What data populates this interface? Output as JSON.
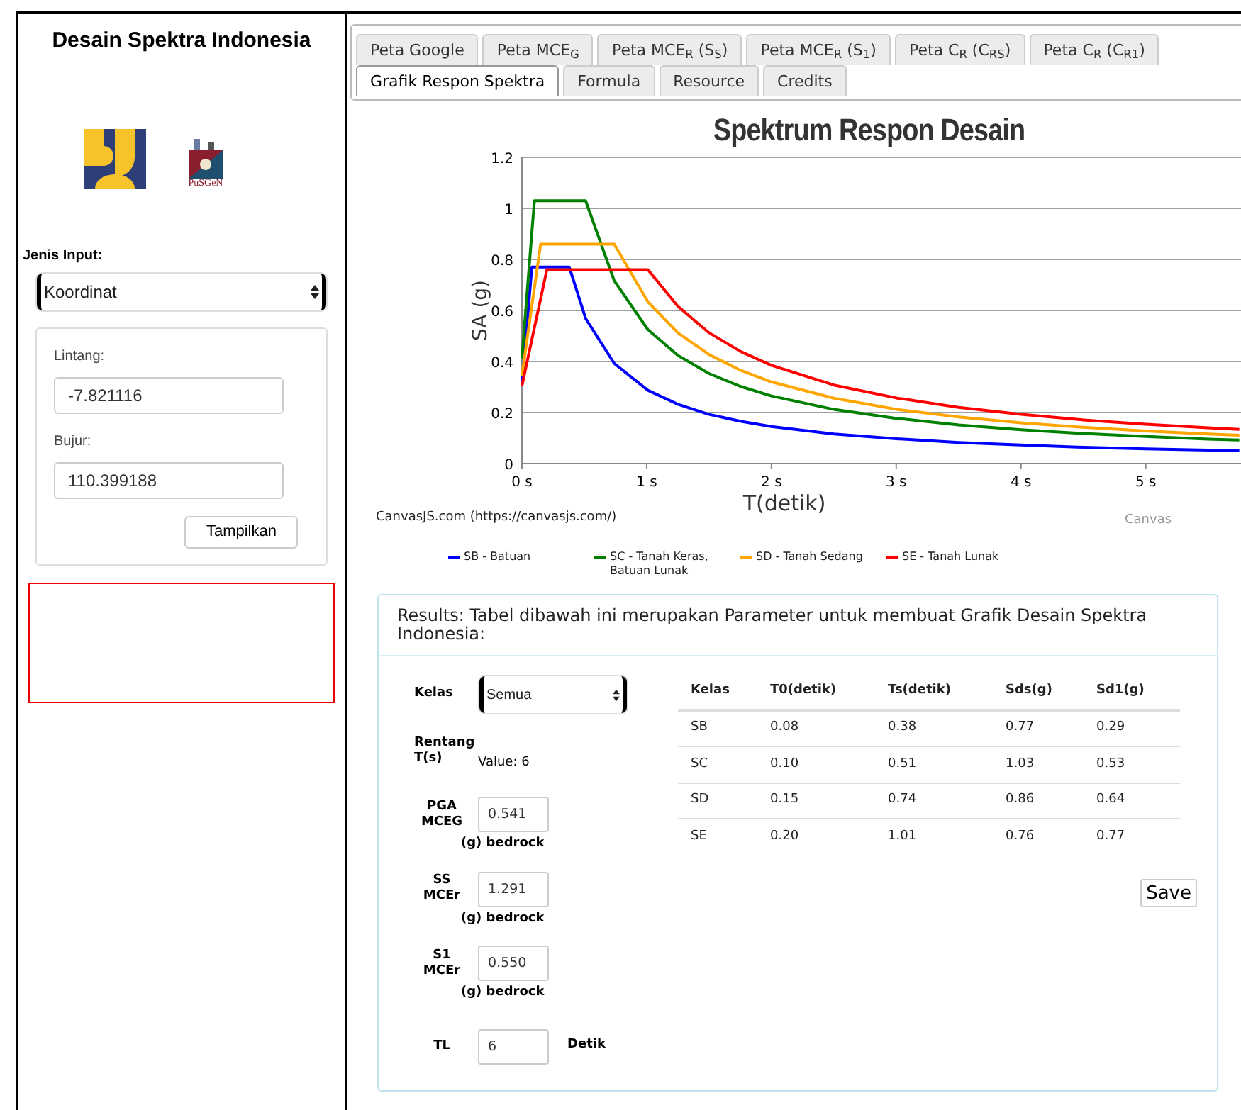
{
  "sidebar": {
    "title": "Desain Spektra Indonesia",
    "logo_text": "PuSGeN",
    "input_type_label": "Jenis Input:",
    "input_type": "Koordinat",
    "fields": [
      {
        "label": "Lintang:",
        "value": "-7.821116"
      },
      {
        "label": "Bujur:",
        "value": "110.399188"
      }
    ],
    "button": "Tampilkan"
  },
  "tabs": [
    {
      "label": "Peta Google",
      "selected": false
    },
    {
      "label": "Peta MCE$_{G}$",
      "selected": false
    },
    {
      "label": "Peta MCE$_{R}$ (S$_{S}$)",
      "selected": false
    },
    {
      "label": "Peta MCE$_{R}$ (S$_{1}$)",
      "selected": false
    },
    {
      "label": "Peta C$_{R}$ (C$_{RS}$)",
      "selected": false
    },
    {
      "label": "Peta C$_{R}$ (C$_{R1}$)",
      "selected": false
    },
    {
      "label": "Grafik Respon Spektra",
      "selected": true
    },
    {
      "label": "Formula",
      "selected": false
    },
    {
      "label": "Resource",
      "selected": false
    },
    {
      "label": "Credits",
      "selected": false
    }
  ],
  "chart": {
    "credit_link": "CanvasJS.com (https://canvasjs.com/)",
    "credit_cut": "Canvas",
    "chart_data": {
      "type": "line",
      "title": "Spektrum Respon Desain",
      "xlabel": "T(detik)",
      "ylabel": "SA (g)",
      "x": [
        0,
        0.08,
        0.1,
        0.15,
        0.2,
        0.38,
        0.51,
        0.74,
        1.01,
        1.25,
        1.5,
        1.75,
        2,
        2.5,
        3,
        3.5,
        4,
        4.5,
        5,
        5.5,
        5.75
      ],
      "series": [
        {
          "name": "SB - Batuan",
          "color": "#0000ff",
          "values": [
            0.308,
            0.77,
            0.77,
            0.77,
            0.77,
            0.77,
            0.569,
            0.392,
            0.287,
            0.232,
            0.193,
            0.166,
            0.145,
            0.116,
            0.097,
            0.083,
            0.073,
            0.064,
            0.058,
            0.053,
            0.05
          ]
        },
        {
          "name": "SC - Tanah Keras, Batuan Lunak",
          "color": "#008000",
          "values": [
            0.412,
            0.906,
            1.03,
            1.03,
            1.03,
            1.03,
            1.03,
            0.716,
            0.525,
            0.424,
            0.353,
            0.303,
            0.265,
            0.212,
            0.177,
            0.151,
            0.133,
            0.118,
            0.106,
            0.096,
            0.092
          ]
        },
        {
          "name": "SD - Tanah Sedang",
          "color": "#ffa500",
          "values": [
            0.344,
            0.619,
            0.688,
            0.86,
            0.86,
            0.86,
            0.86,
            0.86,
            0.634,
            0.512,
            0.427,
            0.366,
            0.32,
            0.256,
            0.213,
            0.183,
            0.16,
            0.142,
            0.128,
            0.116,
            0.111
          ]
        },
        {
          "name": "SE - Tanah Lunak",
          "color": "#ff0000",
          "values": [
            0.304,
            0.486,
            0.532,
            0.646,
            0.76,
            0.76,
            0.76,
            0.76,
            0.76,
            0.616,
            0.513,
            0.44,
            0.385,
            0.308,
            0.257,
            0.22,
            0.193,
            0.171,
            0.154,
            0.14,
            0.134
          ]
        }
      ],
      "xlim": [
        0,
        5.9
      ],
      "ylim": [
        0,
        1.2
      ],
      "grid": true,
      "legend": "bottom",
      "xticks": [
        {
          "value": 0,
          "label": "0 s"
        },
        {
          "value": 1,
          "label": "1 s"
        },
        {
          "value": 2,
          "label": "2 s"
        },
        {
          "value": 3,
          "label": "3 s"
        },
        {
          "value": 4,
          "label": "4 s"
        },
        {
          "value": 5,
          "label": "5 s"
        }
      ],
      "yticks": [
        0,
        0.2,
        0.4,
        0.6,
        0.8,
        1,
        1.2
      ]
    }
  },
  "results": {
    "heading": "Results: Tabel dibawah ini merupakan Parameter untuk membuat Grafik Desain Spektra Indonesia:",
    "form": [
      {
        "kind": "select",
        "label": "Kelas",
        "value": "Semua"
      },
      {
        "kind": "value",
        "label": "Rentang T(s)",
        "value": "Value: 6"
      },
      {
        "kind": "input",
        "label": "PGA MCEG",
        "value": "0.541",
        "unit": "(g) bedrock"
      },
      {
        "kind": "input",
        "label": "SS MCEr",
        "value": "1.291",
        "unit": "(g) bedrock"
      },
      {
        "kind": "input",
        "label": "S1 MCEr",
        "value": "0.550",
        "unit": "(g) bedrock"
      },
      {
        "kind": "inline",
        "label": "TL",
        "value": "6",
        "unit": "Detik"
      }
    ],
    "table": {
      "columns": [
        "Kelas",
        "T0(detik)",
        "Ts(detik)",
        "Sds(g)",
        "Sd1(g)"
      ],
      "rows": [
        [
          "SB",
          "0.08",
          "0.38",
          "0.77",
          "0.29"
        ],
        [
          "SC",
          "0.10",
          "0.51",
          "1.03",
          "0.53"
        ],
        [
          "SD",
          "0.15",
          "0.74",
          "0.86",
          "0.64"
        ],
        [
          "SE",
          "0.20",
          "1.01",
          "0.76",
          "0.77"
        ]
      ]
    },
    "save_button": "Save"
  }
}
